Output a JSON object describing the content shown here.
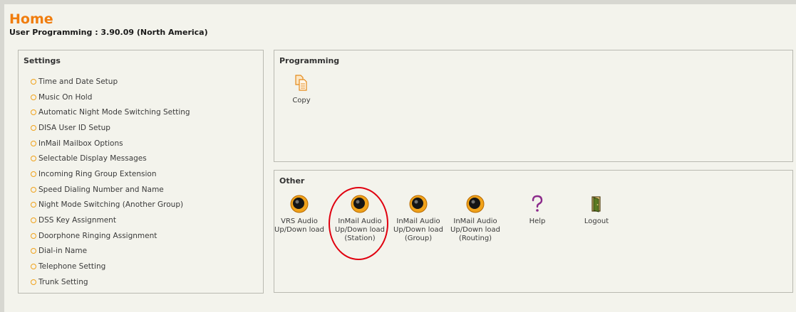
{
  "header": {
    "title": "Home",
    "subtitle": "User Programming : 3.90.09 (North America)"
  },
  "settings": {
    "title": "Settings",
    "items": [
      {
        "label": "Time and Date Setup"
      },
      {
        "label": "Music On Hold"
      },
      {
        "label": "Automatic Night Mode Switching Setting"
      },
      {
        "label": "DISA User ID Setup"
      },
      {
        "label": "InMail Mailbox Options"
      },
      {
        "label": "Selectable Display Messages"
      },
      {
        "label": "Incoming Ring Group Extension"
      },
      {
        "label": "Speed Dialing Number and Name"
      },
      {
        "label": "Night Mode Switching (Another Group)"
      },
      {
        "label": "DSS Key Assignment"
      },
      {
        "label": "Doorphone Ringing Assignment"
      },
      {
        "label": "Dial-in Name"
      },
      {
        "label": "Telephone Setting"
      },
      {
        "label": "Trunk Setting"
      }
    ]
  },
  "programming": {
    "title": "Programming",
    "tools": [
      {
        "label": "Copy",
        "icon": "copy-icon"
      }
    ]
  },
  "other": {
    "title": "Other",
    "tools": [
      {
        "label": "VRS Audio\nUp/Down load",
        "icon": "speaker-icon"
      },
      {
        "label": "InMail Audio\nUp/Down load\n(Station)",
        "icon": "speaker-icon"
      },
      {
        "label": "InMail Audio\nUp/Down load\n(Group)",
        "icon": "speaker-icon"
      },
      {
        "label": "InMail Audio\nUp/Down load\n(Routing)",
        "icon": "speaker-icon"
      },
      {
        "label": "Help",
        "icon": "question-mark-icon"
      },
      {
        "label": "Logout",
        "icon": "door-icon"
      }
    ]
  },
  "colors": {
    "title": "#f07d0e",
    "bullet": "#f0a21a",
    "annotation": "#e0000f",
    "background": "#f3f3ec"
  }
}
